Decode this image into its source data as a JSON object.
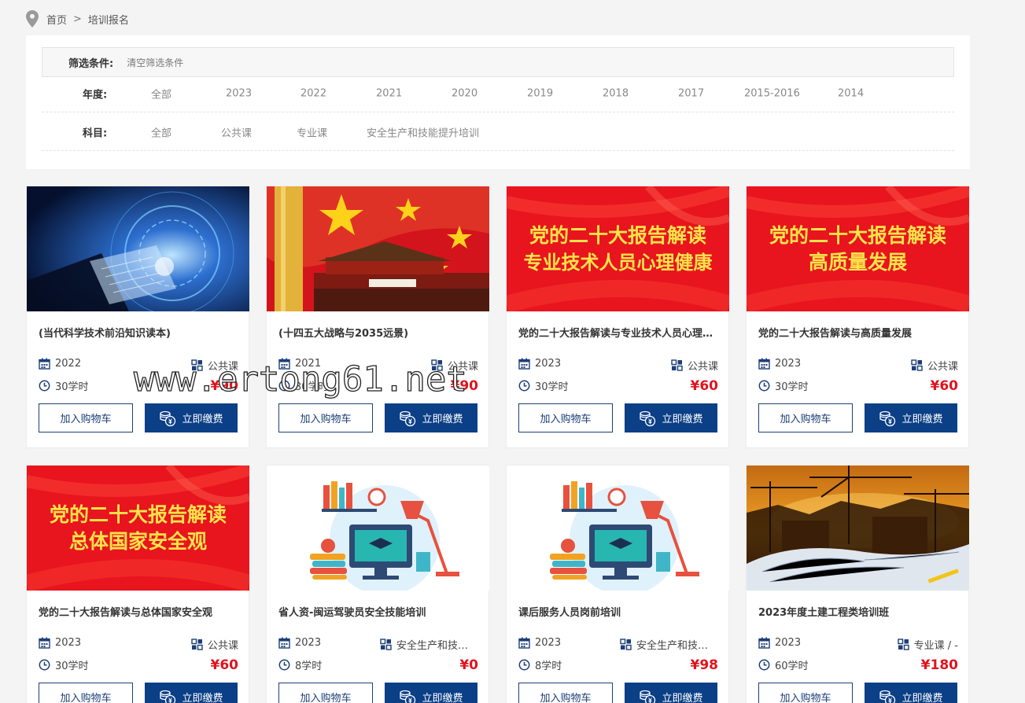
{
  "breadcrumb": {
    "home": "首页",
    "sep": ">",
    "current": "培训报名"
  },
  "filter": {
    "title": "筛选条件:",
    "clear": "清空筛选条件",
    "year_label": "年度:",
    "years": [
      "全部",
      "2023",
      "2022",
      "2021",
      "2020",
      "2019",
      "2018",
      "2017",
      "2015-2016",
      "2014"
    ],
    "subject_label": "科目:",
    "subjects": [
      "全部",
      "公共课",
      "专业课",
      "安全生产和技能提升培训"
    ]
  },
  "cart_label": "加入购物车",
  "pay_label": "立即缴费",
  "cards": [
    {
      "title": "(当代科学技术前沿知识读本)",
      "year": "2022",
      "category": "公共课",
      "hours": "30学时",
      "price": "¥90",
      "banner": "",
      "image": "tech"
    },
    {
      "title": "(十四五大战略与2035远景)",
      "year": "2021",
      "category": "公共课",
      "hours": "30学时",
      "price": "¥90",
      "banner": "",
      "image": "flag"
    },
    {
      "title": "党的二十大报告解读与专业技术人员心理健康",
      "year": "2023",
      "category": "公共课",
      "hours": "30学时",
      "price": "¥60",
      "banner": "党的二十大报告解读|专业技术人员心理健康",
      "image": "red"
    },
    {
      "title": "党的二十大报告解读与高质量发展",
      "year": "2023",
      "category": "公共课",
      "hours": "30学时",
      "price": "¥60",
      "banner": "党的二十大报告解读|高质量发展",
      "image": "red"
    },
    {
      "title": "党的二十大报告解读与总体国家安全观",
      "year": "2023",
      "category": "公共课",
      "hours": "30学时",
      "price": "¥60",
      "banner": "党的二十大报告解读|总体国家安全观",
      "image": "red"
    },
    {
      "title": "省人资-闽运驾驶员安全技能培训",
      "year": "2023",
      "category": "安全生产和技能提升培训",
      "hours": "8学时",
      "price": "¥0",
      "banner": "",
      "image": "study"
    },
    {
      "title": "课后服务人员岗前培训",
      "year": "2023",
      "category": "安全生产和技能提升培训",
      "hours": "8学时",
      "price": "¥98",
      "banner": "",
      "image": "study"
    },
    {
      "title": "2023年度土建工程类培训班",
      "year": "2023",
      "category": "专业课 / -",
      "hours": "60学时",
      "price": "¥180",
      "banner": "",
      "image": "construction"
    }
  ],
  "watermark": "www.ertong61.net",
  "colors": {
    "accent": "#0b3f86",
    "price": "#e0141e",
    "banner_red": "#e8141e",
    "banner_text": "#ffe34a"
  }
}
